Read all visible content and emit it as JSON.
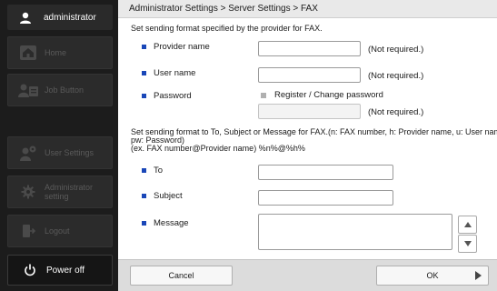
{
  "sidebar": {
    "user": {
      "name": "administrator",
      "icon": "user-icon"
    },
    "items": [
      {
        "label": "Home",
        "icon": "home-icon"
      },
      {
        "label": "Job Button",
        "icon": "job-button-icon"
      },
      {
        "label": "User Settings",
        "icon": "user-settings-icon"
      },
      {
        "label_line1": "Administrator",
        "label_line2": "setting",
        "icon": "gear-icon"
      },
      {
        "label": "Logout",
        "icon": "logout-icon"
      }
    ],
    "power": {
      "label": "Power off",
      "icon": "power-icon"
    }
  },
  "header": {
    "breadcrumb": "Administrator Settings > Server Settings > FAX"
  },
  "provider_section": {
    "note": "Set sending format specified by the provider for FAX.",
    "provider_name": {
      "label": "Provider name",
      "value": "",
      "hint": "(Not required.)"
    },
    "user_name": {
      "label": "User name",
      "value": "",
      "hint": "(Not required.)"
    },
    "password": {
      "label": "Password",
      "checkbox_label": "Register / Change password",
      "value": "",
      "hint": "(Not required.)"
    }
  },
  "format_section": {
    "note_line1": "Set sending format to To, Subject or Message for FAX.(n: FAX number, h: Provider name, u: User name,",
    "note_line2": "pw: Password)",
    "note_line3": "(ex. FAX number@Provider name) %n%@%h%",
    "to": {
      "label": "To",
      "value": ""
    },
    "subject": {
      "label": "Subject",
      "value": ""
    },
    "message": {
      "label": "Message",
      "value": ""
    }
  },
  "footer": {
    "cancel_label": "Cancel",
    "ok_label": "OK"
  },
  "colors": {
    "sidebar_bg": "#1c1c1c",
    "bullet": "#1a47b8",
    "header_bg": "#e9e9e9",
    "footer_bg": "#dcdcdc"
  }
}
